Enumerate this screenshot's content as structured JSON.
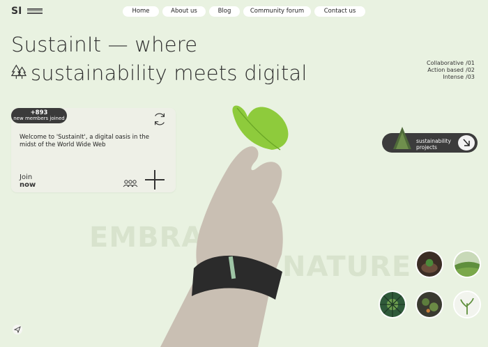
{
  "brand": {
    "logo": "SI"
  },
  "nav": {
    "items": [
      "Home",
      "About us",
      "Blog",
      "Community forum",
      "Contact us"
    ]
  },
  "hero": {
    "line1": "SustainIt — where",
    "line2": "sustainability meets digital"
  },
  "stats": [
    {
      "label": "Collaborative",
      "num": "/01"
    },
    {
      "label": "Action based",
      "num": "/02"
    },
    {
      "label": "Intense",
      "num": "/03"
    }
  ],
  "card": {
    "badge_count": "+893",
    "badge_text": "new members joined",
    "welcome": "Welcome to 'SustainIt', a digital oasis in the midst of the World Wide Web",
    "join_line1": "Join",
    "join_line2": "now"
  },
  "background": {
    "word1": "EMBRACE",
    "word2": "NATURE"
  },
  "projects": {
    "label_line1": "sustainability",
    "label_line2": "projects"
  },
  "icons": [
    "menu-icon",
    "tree-icon",
    "refresh-icon",
    "people-icon",
    "plus-icon",
    "arrow-down-right-icon",
    "send-icon"
  ],
  "colors": {
    "background": "#e9f2e1",
    "dark": "#3a3a3a",
    "leaf": "#8ecb3c"
  }
}
